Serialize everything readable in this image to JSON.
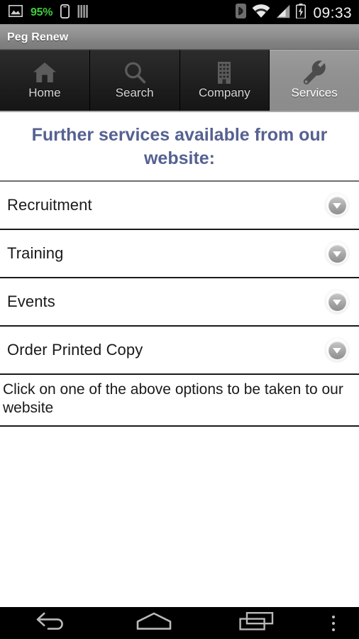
{
  "status_bar": {
    "battery_percent": "95%",
    "clock": "09:33",
    "icons_left": [
      "image-icon",
      "battery-percent-text",
      "sim-card-icon",
      "signal-bars-icon"
    ],
    "icons_right": [
      "bluetooth-icon",
      "wifi-icon",
      "cellular-signal-icon",
      "battery-charging-icon"
    ],
    "battery_text_color": "#3ecb3e"
  },
  "title_bar": {
    "app_title": "Peg Renew"
  },
  "tabs": [
    {
      "label": "Home",
      "icon": "home-icon",
      "selected": false
    },
    {
      "label": "Search",
      "icon": "search-icon",
      "selected": false
    },
    {
      "label": "Company",
      "icon": "building-icon",
      "selected": false
    },
    {
      "label": "Services",
      "icon": "wrench-icon",
      "selected": true
    }
  ],
  "content": {
    "heading": "Further services available from our website:",
    "heading_color": "#556191",
    "options": [
      {
        "label": "Recruitment",
        "icon": "chevron-down-icon"
      },
      {
        "label": "Training",
        "icon": "chevron-down-icon"
      },
      {
        "label": "Events",
        "icon": "chevron-down-icon"
      },
      {
        "label": "Order Printed Copy",
        "icon": "chevron-down-icon"
      }
    ],
    "footer_note": "Click on one of the above options to be taken to our website"
  },
  "nav_bar": {
    "buttons": [
      {
        "name": "back-icon"
      },
      {
        "name": "home-icon"
      },
      {
        "name": "recent-apps-icon"
      },
      {
        "name": "overflow-menu-icon"
      }
    ]
  }
}
